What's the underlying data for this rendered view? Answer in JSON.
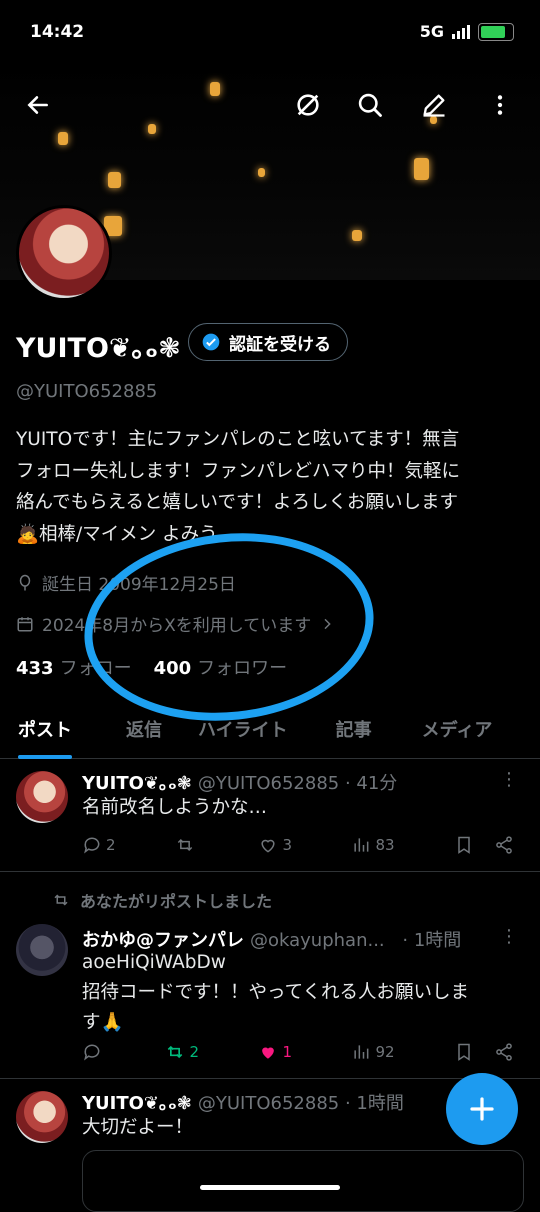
{
  "status": {
    "time": "14:42",
    "network": "5G"
  },
  "profile": {
    "name": "YUITO❦｡ₒ❃",
    "verify_label": "認証を受ける",
    "handle": "@YUITO652885",
    "bio_lines": [
      "YUITOです！主にファンパレのこと呟いてます！無言",
      "フォロー失礼します！ファンパレどハマり中！気軽に",
      "絡んでもらえると嬉しいです！よろしくお願いします",
      "🙇相棒/マイメン よみう"
    ],
    "birthday": "誕生日 2009年12月25日",
    "joined": "2024年8月からXを利用しています",
    "following_count": "433",
    "following_label": "フォロー",
    "followers_count": "400",
    "followers_label": "フォロワー"
  },
  "tabs": [
    "ポスト",
    "返信",
    "ハイライト",
    "記事",
    "メディア"
  ],
  "posts": [
    {
      "name": "YUITO❦｡ₒ❃",
      "handle": "@YUITO652885 · 41分",
      "text": "名前改名しようかな…",
      "replies": "2",
      "reposts": "",
      "likes": "3",
      "views": "83"
    },
    {
      "repost_note": "あなたがリポストしました",
      "name": "おかゆ@ファンパレ",
      "handle": "@okayuphan...",
      "time": "· 1時間",
      "text_lines": [
        "aoeHiQiWAbDw",
        "招待コードです！！やってくれる人お願いしま",
        "す🙏"
      ],
      "replies": "",
      "reposts": "2",
      "likes": "1",
      "views": "92"
    },
    {
      "name": "YUITO❦｡ₒ❃",
      "handle": "@YUITO652885 · 1時間",
      "text": "大切だよー！"
    }
  ],
  "colors": {
    "accent": "#1d9bf0",
    "repost_green": "#00ba7c",
    "like_pink": "#f91880",
    "annotation": "#1da1f2"
  }
}
